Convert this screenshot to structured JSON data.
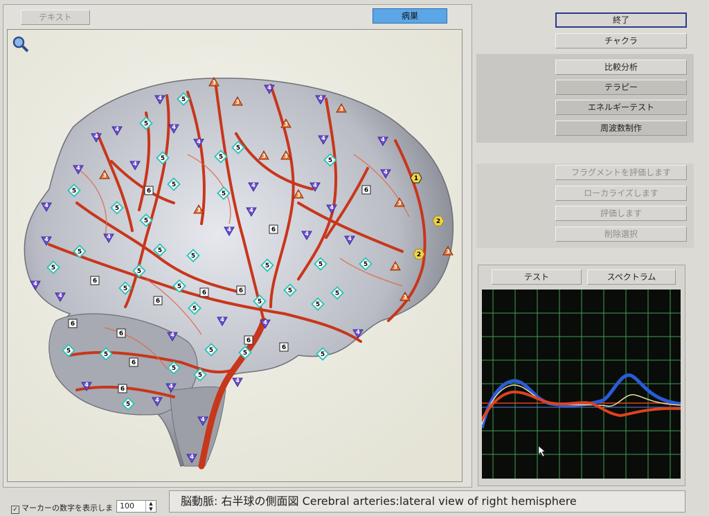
{
  "tabs": {
    "text": "テキスト",
    "focus": "病巣"
  },
  "menu": {
    "exit": "終了",
    "chakra": "チャクラ",
    "compare": "比較分析",
    "therapy": "テラピー",
    "energy_test": "エネルギーテスト",
    "frequency": "周波数制作",
    "fragment_eval": "フラグメントを評価します",
    "localize": "ローカライズします",
    "evaluate": "評価します",
    "delete_selection": "削除選択"
  },
  "graph_tabs": {
    "test": "テスト",
    "spectrum": "スペクトラム"
  },
  "footer": {
    "checkbox_label": "マーカーの数字を表示しま",
    "spin_value": "100",
    "status_text": "脳動脈: 右半球の側面図 Cerebral arteries:lateral view of right hemisphere"
  },
  "markers": {
    "m1": "1",
    "m2": "2",
    "m3": "3",
    "m4": "4",
    "m5": "5",
    "m6": "6"
  },
  "colors": {
    "accent": "#5aa6e6",
    "grid": "#4fd06a",
    "blue_line": "#2a5bd8",
    "red_line": "#e0421e"
  }
}
